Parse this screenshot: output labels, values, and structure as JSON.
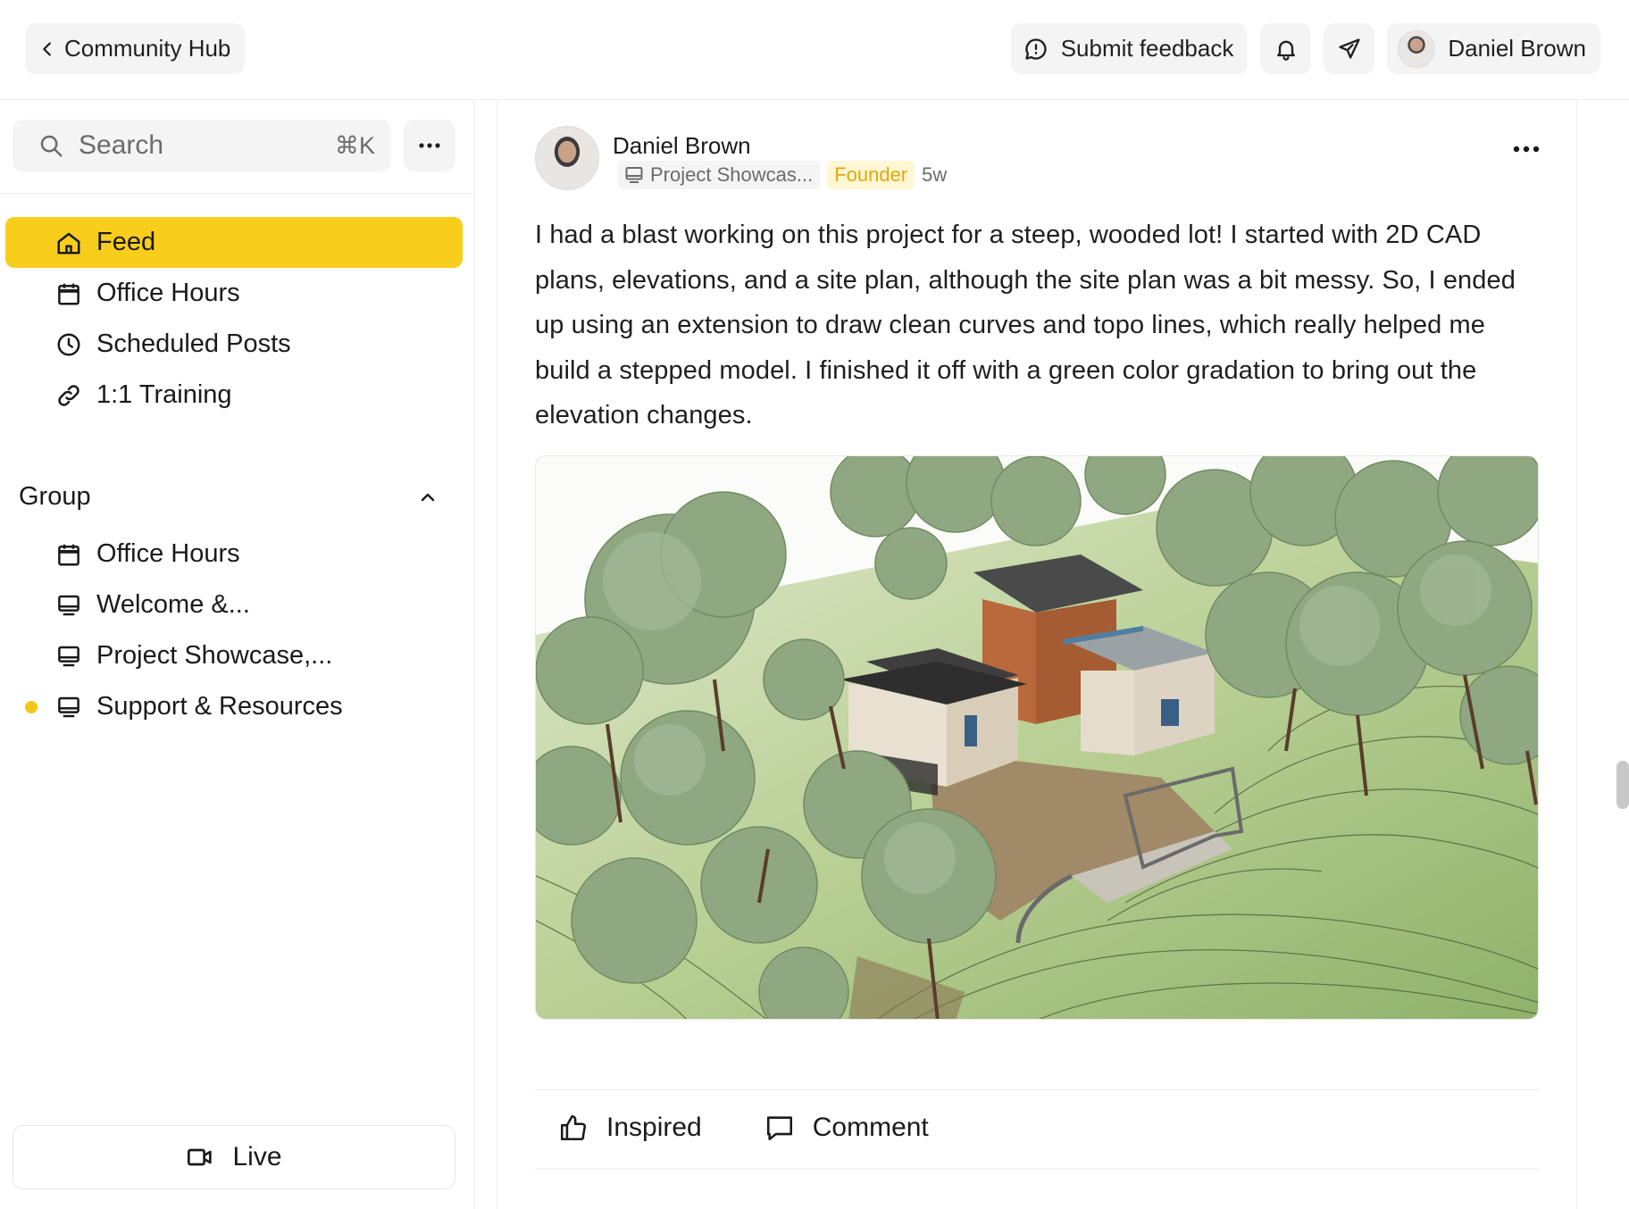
{
  "header": {
    "back_label": "Community Hub",
    "feedback_label": "Submit feedback",
    "user_name": "Daniel Brown"
  },
  "sidebar": {
    "search_placeholder": "Search",
    "search_shortcut": "⌘K",
    "nav": [
      {
        "label": "Feed",
        "icon": "home-icon",
        "active": true
      },
      {
        "label": "Office Hours",
        "icon": "calendar-icon"
      },
      {
        "label": "Scheduled Posts",
        "icon": "clock-icon"
      },
      {
        "label": "1:1 Training",
        "icon": "link-icon"
      }
    ],
    "group_title": "Group",
    "group_items": [
      {
        "label": "Office Hours",
        "icon": "calendar-icon"
      },
      {
        "label": "Welcome &...",
        "icon": "monitor-icon"
      },
      {
        "label": "Project Showcase,...",
        "icon": "monitor-icon"
      },
      {
        "label": "Support & Resources",
        "icon": "monitor-icon",
        "unread": true
      }
    ],
    "live_label": "Live"
  },
  "post": {
    "author": "Daniel Brown",
    "space": "Project Showcas...",
    "badge": "Founder",
    "time": "5w",
    "body": "I had a blast working on this project for a steep, wooded lot! I started with 2D CAD plans, elevations, and a site plan, although the site plan was a bit messy. So, I ended up using an extension to draw clean curves and topo lines, which really helped me build a stepped model. I finished it off with a green color gradation to bring out the elevation changes.",
    "actions": {
      "inspired": "Inspired",
      "comment": "Comment"
    }
  },
  "colors": {
    "accent": "#f8cd1c",
    "badge_text": "#e2a80d",
    "badge_bg": "#fff6d4",
    "unread_dot": "#f5c518"
  }
}
